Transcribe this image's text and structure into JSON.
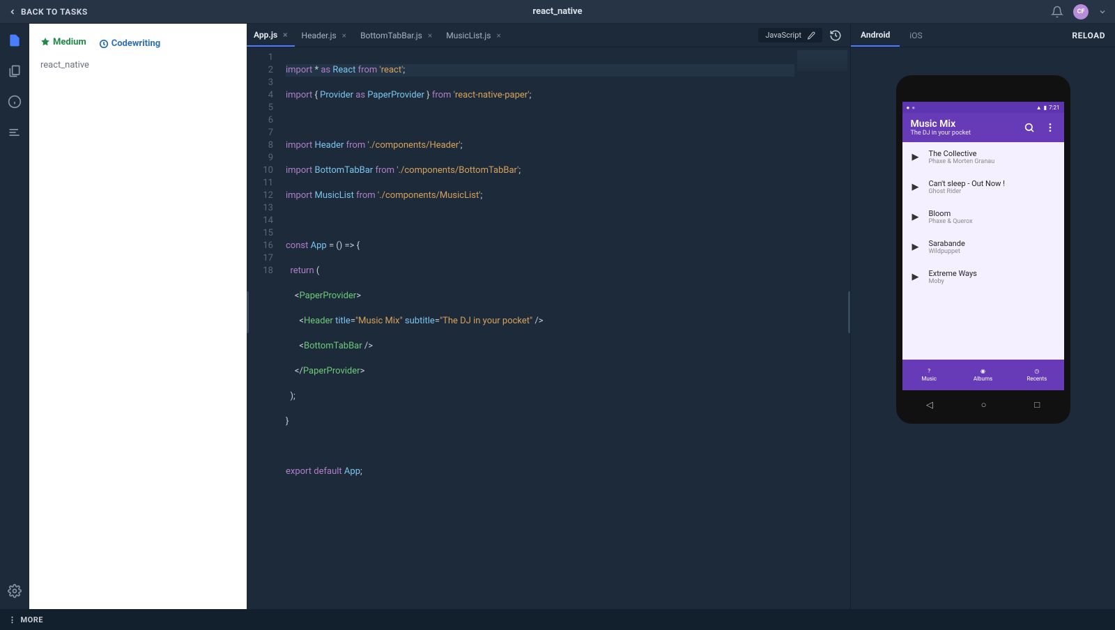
{
  "top": {
    "back": "BACK TO TASKS",
    "title": "react_native",
    "avatar": "CF"
  },
  "sidebar": {
    "tag_medium": "Medium",
    "tag_codewriting": "Codewriting",
    "project": "react_native"
  },
  "tabs": [
    {
      "label": "App.js",
      "active": true
    },
    {
      "label": "Header.js",
      "active": false
    },
    {
      "label": "BottomTabBar.js",
      "active": false
    },
    {
      "label": "MusicList.js",
      "active": false
    }
  ],
  "toolbar": {
    "language": "JavaScript"
  },
  "preview": {
    "tabs": [
      {
        "label": "Android",
        "active": true
      },
      {
        "label": "iOS",
        "active": false
      }
    ],
    "reload": "RELOAD"
  },
  "phone": {
    "time": "7:21",
    "appbar_title": "Music Mix",
    "appbar_subtitle": "The DJ in your pocket",
    "songs": [
      {
        "title": "The Collective",
        "artist": "Phaxe & Morten Granau"
      },
      {
        "title": "Can't sleep - Out Now !",
        "artist": "Ghost Rider"
      },
      {
        "title": "Bloom",
        "artist": "Phaxe & Querox"
      },
      {
        "title": "Sarabande",
        "artist": "Wildpuppet"
      },
      {
        "title": "Extreme Ways",
        "artist": "Moby"
      }
    ],
    "nav": [
      {
        "label": "Music"
      },
      {
        "label": "Albums"
      },
      {
        "label": "Recents"
      }
    ]
  },
  "footer": {
    "more": "MORE"
  },
  "lines": [
    "1",
    "2",
    "3",
    "4",
    "5",
    "6",
    "7",
    "8",
    "9",
    "10",
    "11",
    "12",
    "13",
    "14",
    "15",
    "16",
    "17",
    "18"
  ]
}
